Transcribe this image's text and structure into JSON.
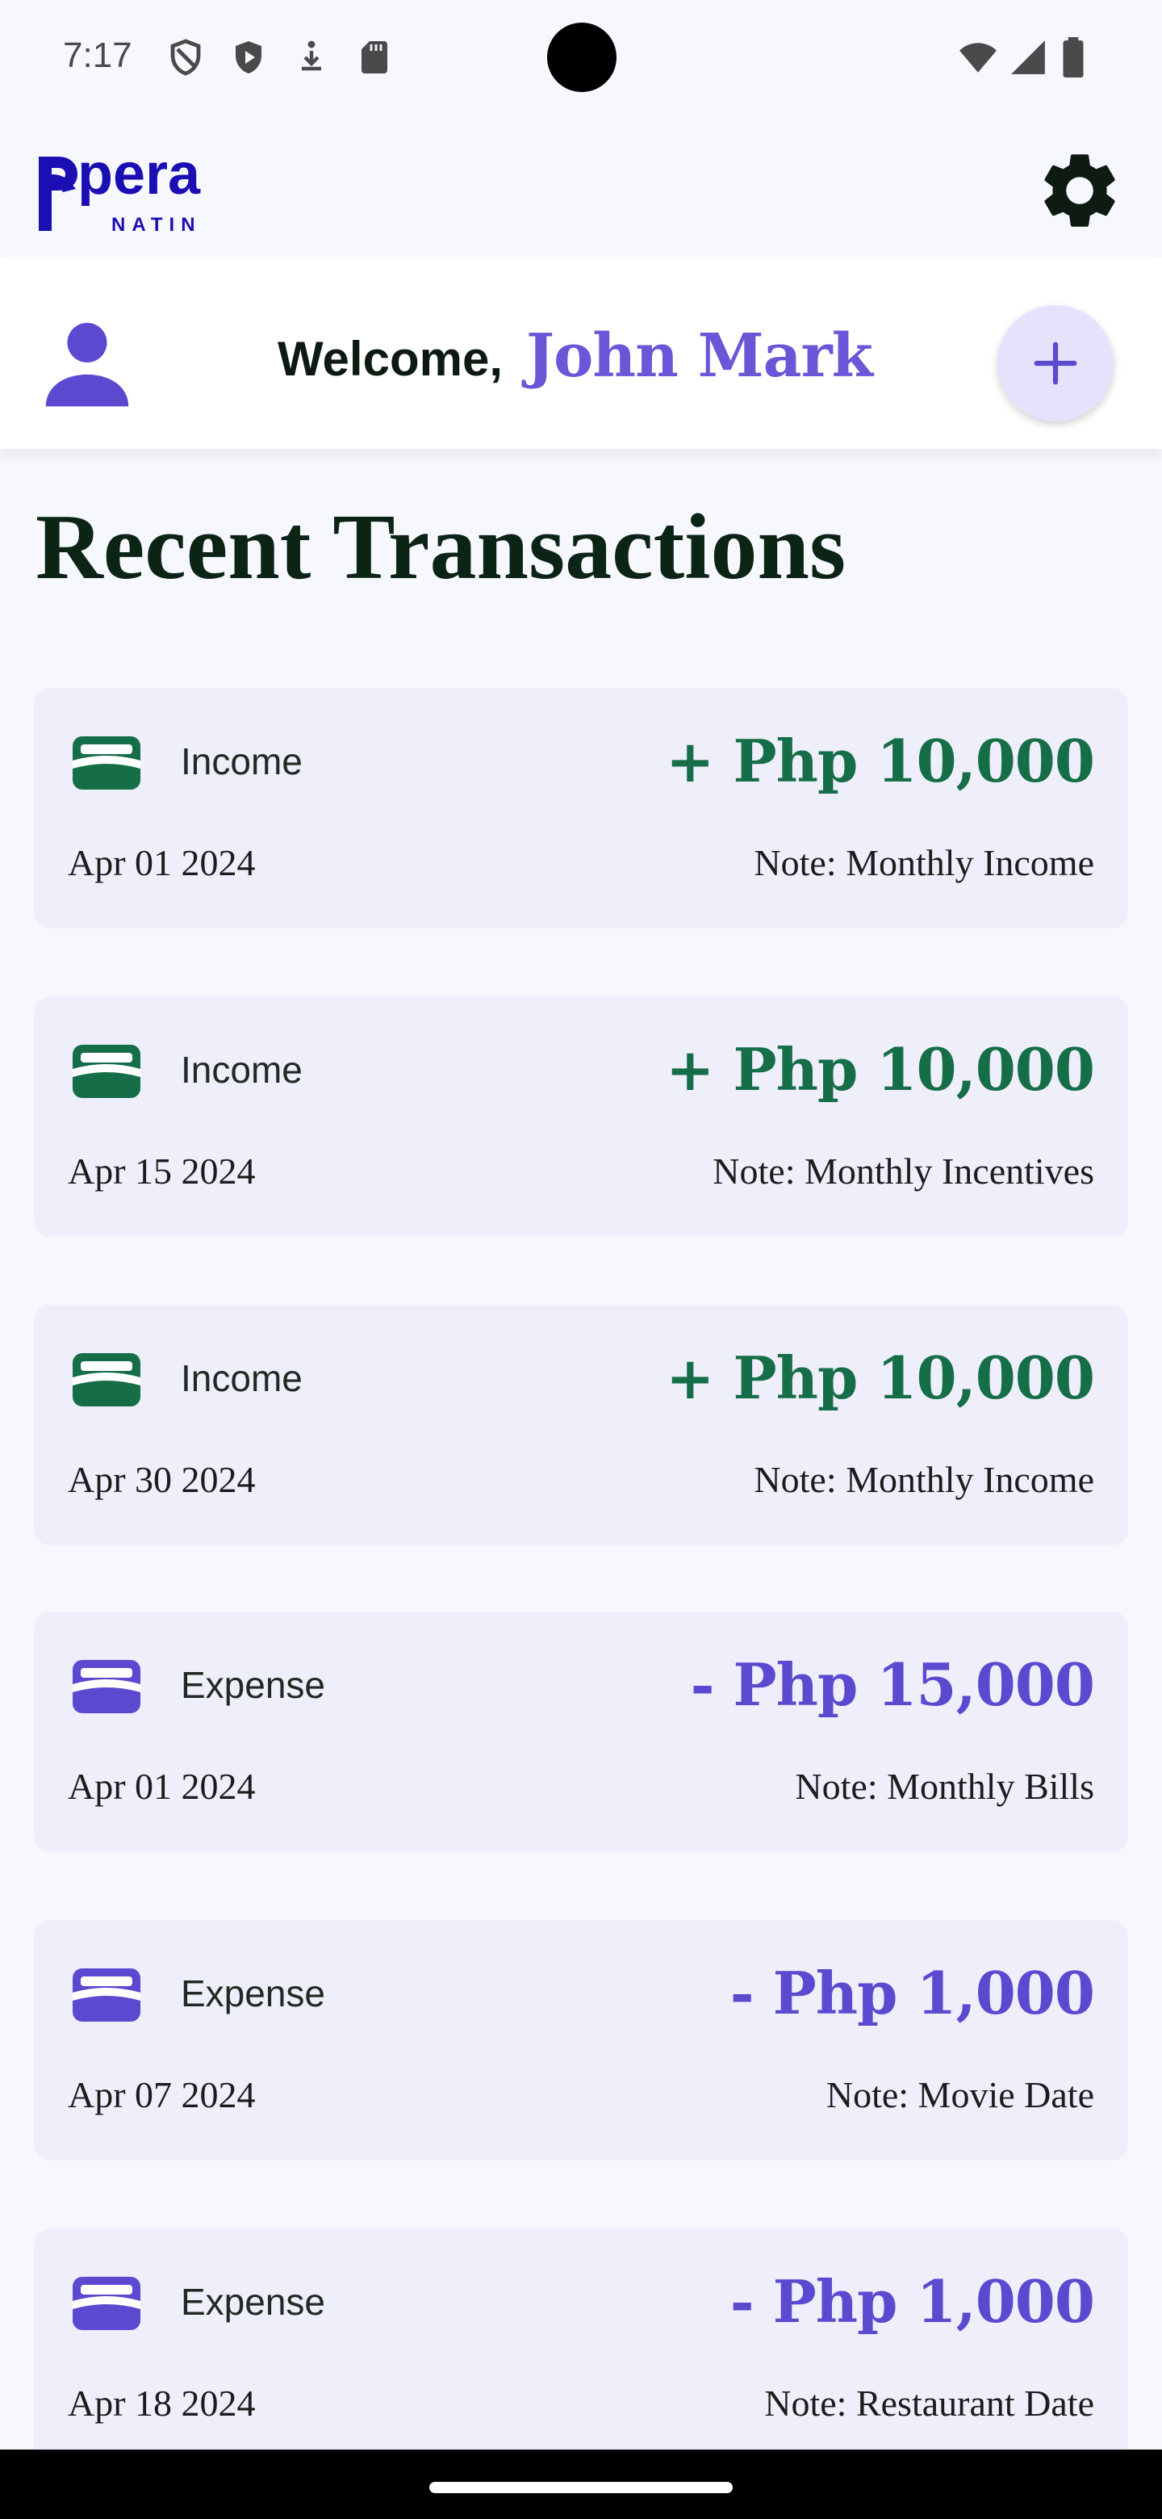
{
  "status_bar": {
    "time": "7:17",
    "icons": [
      "shield-outline-icon",
      "shield-play-icon",
      "download-person-icon",
      "sd-card-icon",
      "wifi-icon",
      "cell-signal-icon",
      "battery-icon"
    ]
  },
  "app_bar": {
    "logo_word": "pera",
    "logo_sub": "NATIN",
    "settings_icon": "gear-icon"
  },
  "welcome": {
    "greeting": "Welcome,",
    "name": "John Mark",
    "add_icon": "plus-icon"
  },
  "section_title": "Recent Transactions",
  "colors": {
    "income": "#166e48",
    "expense": "#5b49d0",
    "accent": "#6a56d6",
    "card_bg": "#efeefb"
  },
  "transactions": [
    {
      "type": "Income",
      "amount": "+ Php 10,000",
      "date": "Apr 01 2024",
      "note": "Note: Monthly Income",
      "kind": "income"
    },
    {
      "type": "Income",
      "amount": "+ Php 10,000",
      "date": "Apr 15 2024",
      "note": "Note: Monthly Incentives",
      "kind": "income"
    },
    {
      "type": "Income",
      "amount": "+ Php 10,000",
      "date": "Apr 30 2024",
      "note": "Note: Monthly Income",
      "kind": "income"
    },
    {
      "type": "Expense",
      "amount": "- Php 15,000",
      "date": "Apr 01 2024",
      "note": "Note: Monthly Bills",
      "kind": "expense"
    },
    {
      "type": "Expense",
      "amount": "- Php 1,000",
      "date": "Apr 07 2024",
      "note": "Note: Movie Date",
      "kind": "expense"
    },
    {
      "type": "Expense",
      "amount": "- Php 1,000",
      "date": "Apr 18 2024",
      "note": "Note: Restaurant Date",
      "kind": "expense"
    }
  ]
}
